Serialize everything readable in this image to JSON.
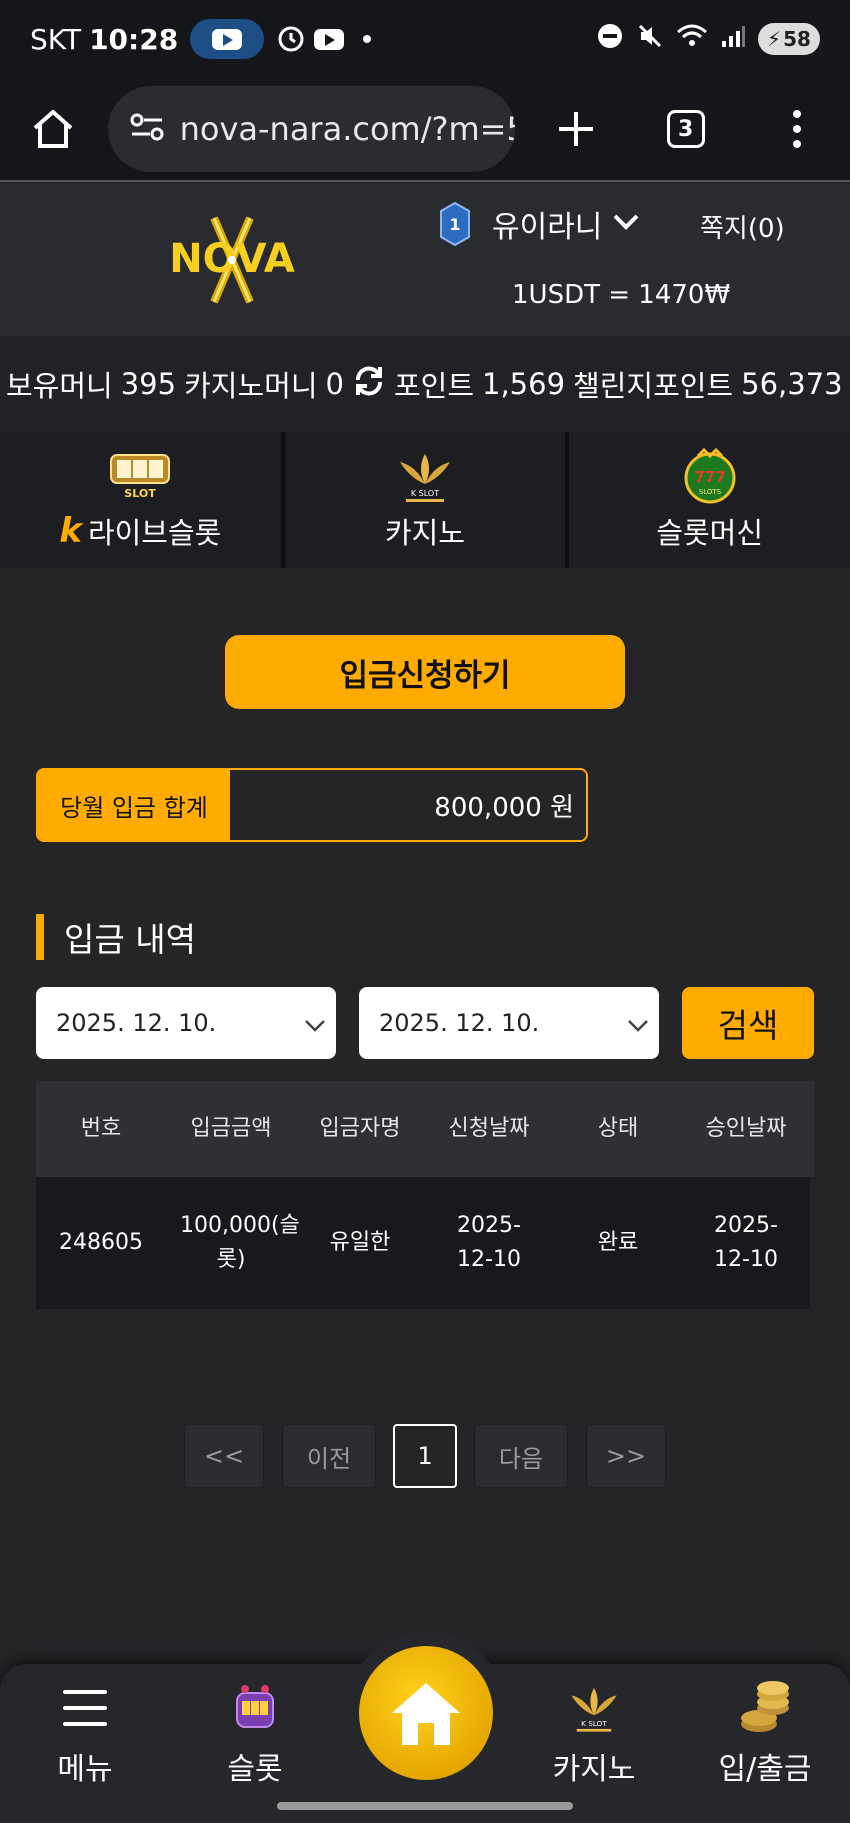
{
  "status_bar": {
    "carrier": "SKT",
    "time": "10:28",
    "battery": "58"
  },
  "browser": {
    "url": "nova-nara.com/?m=5",
    "tab_count": "3"
  },
  "header": {
    "logo_text": "NOVA",
    "level": "1",
    "username": "유이라니",
    "messages": "쪽지(0)",
    "exchange_rate": "1USDT = 1470₩"
  },
  "money": {
    "holding_label": "보유머니",
    "holding_value": "395",
    "casino_label": "카지노머니",
    "casino_value": "0",
    "point_label": "포인트",
    "point_value": "1,569",
    "challenge_label": "챌린지포인트",
    "challenge_value": "56,373"
  },
  "categories": [
    {
      "label": "라이브슬롯",
      "badge": "LIVE SLOT",
      "icon": "live-slot-icon"
    },
    {
      "label": "카지노",
      "badge": "K SLOT",
      "icon": "casino-lotus-icon"
    },
    {
      "label": "슬롯머신",
      "badge": "777 SLOTS",
      "icon": "slot-machine-icon"
    }
  ],
  "deposit_button": "입금신청하기",
  "monthly_total": {
    "label": "당월 입금 합계",
    "value": "800,000 원"
  },
  "history": {
    "title": "입금 내역",
    "date_from": "2025. 12. 10.",
    "date_to": "2025. 12. 10.",
    "search_label": "검색",
    "columns": [
      "번호",
      "입금금액",
      "입금자명",
      "신청날짜",
      "상태",
      "승인날짜"
    ],
    "rows": [
      [
        "248605",
        "100,000(슬롯)",
        "유일한",
        "2025-12-10",
        "완료",
        "2025-12-10"
      ]
    ]
  },
  "pagination": {
    "first": "<<",
    "prev": "이전",
    "current": "1",
    "next": "다음",
    "last": ">>"
  },
  "bottom_nav": {
    "menu": "메뉴",
    "slot": "슬롯",
    "casino": "카지노",
    "banking": "입/출금"
  },
  "colors": {
    "accent": "#ffab00",
    "background": "#252528",
    "header": "#2a2b30"
  }
}
